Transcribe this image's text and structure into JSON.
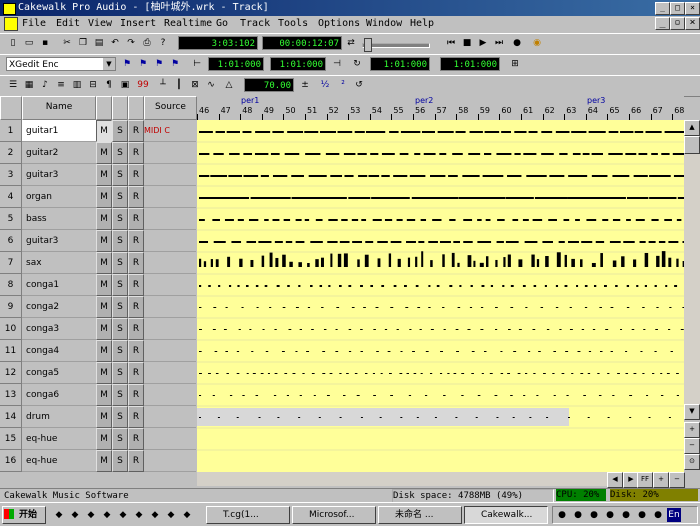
{
  "window": {
    "title": "Cakewalk Pro Audio - [柚叶城外.wrk - Track]"
  },
  "menu": [
    "File",
    "Edit",
    "View",
    "Insert",
    "Realtime",
    "Go",
    "Track",
    "Tools",
    "Options",
    "Window",
    "Help"
  ],
  "transport": {
    "now_time": "3:03:102",
    "smpte": "00:00:12:07"
  },
  "toolbar2": {
    "sync_combo": "XGedit Enc",
    "from": "1:01:000",
    "thru": "1:01:000",
    "loop_start": "1:01:000",
    "loop_end": "1:01:000"
  },
  "toolbar3": {
    "tempo": "70.00"
  },
  "tracks_header": {
    "name": "Name",
    "source": "Source"
  },
  "ruler": {
    "ticks": [
      "46",
      "47",
      "48",
      "49",
      "50",
      "51",
      "52",
      "53",
      "54",
      "55",
      "56",
      "57",
      "58",
      "59",
      "60",
      "61",
      "62",
      "63",
      "64",
      "65",
      "66",
      "67",
      "68"
    ],
    "markers": [
      "per1",
      "per2",
      "per3"
    ]
  },
  "tracks": [
    {
      "num": "1",
      "name": "guitar1",
      "m": "M",
      "s": "S",
      "r": "R",
      "source": "MIDI C"
    },
    {
      "num": "2",
      "name": "guitar2",
      "m": "M",
      "s": "S",
      "r": "R",
      "source": ""
    },
    {
      "num": "3",
      "name": "guitar3",
      "m": "M",
      "s": "S",
      "r": "R",
      "source": ""
    },
    {
      "num": "4",
      "name": "organ",
      "m": "M",
      "s": "S",
      "r": "R",
      "source": ""
    },
    {
      "num": "5",
      "name": "bass",
      "m": "M",
      "s": "S",
      "r": "R",
      "source": ""
    },
    {
      "num": "6",
      "name": "guitar3",
      "m": "M",
      "s": "S",
      "r": "R",
      "source": ""
    },
    {
      "num": "7",
      "name": "sax",
      "m": "M",
      "s": "S",
      "r": "R",
      "source": ""
    },
    {
      "num": "8",
      "name": "conga1",
      "m": "M",
      "s": "S",
      "r": "R",
      "source": ""
    },
    {
      "num": "9",
      "name": "conga2",
      "m": "M",
      "s": "S",
      "r": "R",
      "source": ""
    },
    {
      "num": "10",
      "name": "conga3",
      "m": "M",
      "s": "S",
      "r": "R",
      "source": ""
    },
    {
      "num": "11",
      "name": "conga4",
      "m": "M",
      "s": "S",
      "r": "R",
      "source": ""
    },
    {
      "num": "12",
      "name": "conga5",
      "m": "M",
      "s": "S",
      "r": "R",
      "source": ""
    },
    {
      "num": "13",
      "name": "conga6",
      "m": "M",
      "s": "S",
      "r": "R",
      "source": ""
    },
    {
      "num": "14",
      "name": "drum",
      "m": "M",
      "s": "S",
      "r": "R",
      "source": ""
    },
    {
      "num": "15",
      "name": "eq-hue",
      "m": "M",
      "s": "S",
      "r": "R",
      "source": ""
    },
    {
      "num": "16",
      "name": "eq-hue",
      "m": "M",
      "s": "S",
      "r": "R",
      "source": ""
    }
  ],
  "status": {
    "left": "Cakewalk Music Software",
    "disk": "Disk space: 4788MB (49%)",
    "cpu": "CPU: 20%",
    "disk_pct": "Disk: 20%"
  },
  "taskbar": {
    "start": "开始",
    "tasks": [
      "T.cg(1...",
      "Microsof...",
      "未命名 ...",
      "Cakewalk..."
    ],
    "tray_time": ""
  }
}
